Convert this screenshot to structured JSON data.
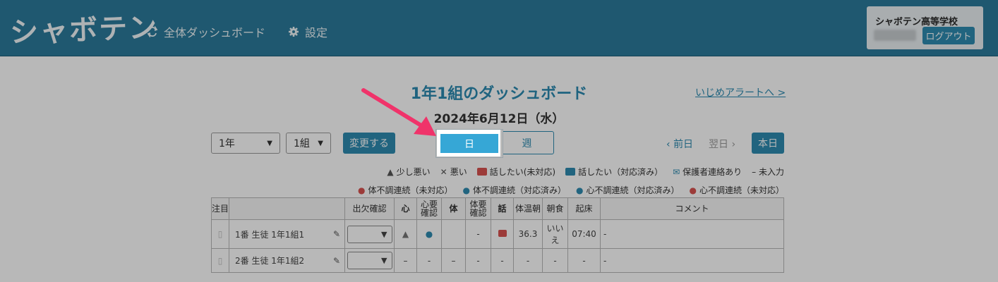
{
  "header": {
    "logo": "シャボテン",
    "nav_dashboard": "全体ダッシュボード",
    "nav_settings": "設定",
    "school_name": "シャボテン高等学校",
    "logout": "ログアウト",
    "bg_color": "#2b7b9b"
  },
  "main": {
    "title": "1年1組のダッシュボード",
    "bully_link": "いじめアラートへ >",
    "date": "2024年6月12日（水）",
    "year_select": "1年",
    "class_select": "1組",
    "change_button": "変更する",
    "toggle_day": "日",
    "toggle_week": "週",
    "prev_day": "前日",
    "next_day": "翌日",
    "today": "本日",
    "accent_color": "#2e8bb0"
  },
  "legend": {
    "row1": [
      "少し悪い",
      "悪い",
      "話したい(未対応)",
      "話したい（対応済み）",
      "保護者連絡あり",
      "– 未入力"
    ],
    "row2": [
      "体不調連続（未対応）",
      "体不調連続（対応済み）",
      "心不調連続（対応済み）",
      "心不調連続（未対応）"
    ]
  },
  "table": {
    "headers": {
      "note": "注目",
      "attendance": "出欠確認",
      "mind": "心",
      "mind_check": "心要確認",
      "body": "体",
      "body_check": "体要確認",
      "talk": "話",
      "temp": "体温朝",
      "breakfast": "朝食",
      "wake": "起床",
      "comment": "コメント"
    },
    "rows": [
      {
        "no": "1番",
        "name": "生徒 1年1組1",
        "body_check": "-",
        "temp": "36.3",
        "breakfast": "いいえ",
        "wake": "07:40",
        "comment": "-"
      },
      {
        "no": "2番",
        "name": "生徒 1年1組2",
        "mind": "–",
        "mind_check": "-",
        "body": "–",
        "body_check": "-",
        "talk": "-",
        "temp": "-",
        "breakfast": "-",
        "wake": "-",
        "comment": "-"
      }
    ]
  }
}
